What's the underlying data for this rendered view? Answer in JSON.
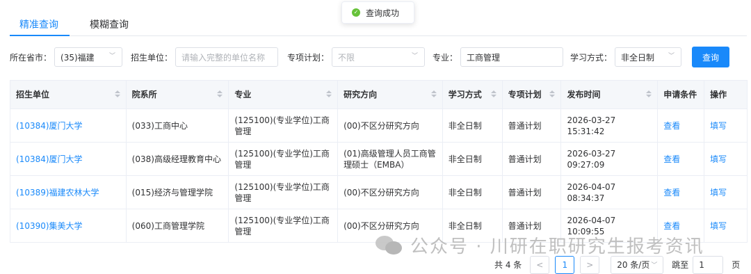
{
  "toast": {
    "text": "查询成功",
    "icon": "check-circle-icon",
    "color": "#67c23a"
  },
  "tabs": [
    {
      "label": "精准查询",
      "active": true
    },
    {
      "label": "模糊查询",
      "active": false
    }
  ],
  "filters": {
    "province_label": "所在省市：",
    "province_value": "(35)福建",
    "unit_label": "招生单位：",
    "unit_placeholder": "请输入完整的单位名称",
    "plan_label": "专项计划：",
    "plan_value": "不限",
    "major_label": "专业：",
    "major_value": "工商管理",
    "mode_label": "学习方式：",
    "mode_value": "非全日制",
    "search_button": "查询"
  },
  "table": {
    "headers": [
      "招生单位",
      "院系所",
      "专业",
      "研究方向",
      "学习方式",
      "专项计划",
      "发布时间",
      "申请条件",
      "操作"
    ],
    "rows": [
      {
        "unit": "(10384)厦门大学",
        "dept": "(033)工商中心",
        "major": "(125100)(专业学位)工商管理",
        "direction": "(00)不区分研究方向",
        "mode": "非全日制",
        "plan": "普通计划",
        "time": "2026-03-27 15:31:42",
        "cond": "查看",
        "op": "填写"
      },
      {
        "unit": "(10384)厦门大学",
        "dept": "(038)高级经理教育中心",
        "major": "(125100)(专业学位)工商管理",
        "direction": "(01)高级管理人员工商管理硕士（EMBA）",
        "mode": "非全日制",
        "plan": "普通计划",
        "time": "2026-03-27 09:27:09",
        "cond": "查看",
        "op": "填写"
      },
      {
        "unit": "(10389)福建农林大学",
        "dept": "(015)经济与管理学院",
        "major": "(125100)(专业学位)工商管理",
        "direction": "(00)不区分研究方向",
        "mode": "非全日制",
        "plan": "普通计划",
        "time": "2026-04-07 08:34:37",
        "cond": "查看",
        "op": "填写"
      },
      {
        "unit": "(10390)集美大学",
        "dept": "(060)工商管理学院",
        "major": "(125100)(专业学位)工商管理",
        "direction": "(00)不区分研究方向",
        "mode": "非全日制",
        "plan": "普通计划",
        "time": "2026-04-07 10:09:55",
        "cond": "查看",
        "op": "填写"
      }
    ]
  },
  "watermark": {
    "text": "公众号 · 川研在职研究生报考资讯",
    "icon": "wechat-icon"
  },
  "pagination": {
    "total": "共 4 条",
    "prev": "<",
    "page": "1",
    "next": ">",
    "page_size": "20 条/页",
    "jump_label": "跳至",
    "jump_value": "1",
    "page_suffix": "页"
  },
  "colors": {
    "accent": "#1989fa",
    "success": "#67c23a"
  }
}
